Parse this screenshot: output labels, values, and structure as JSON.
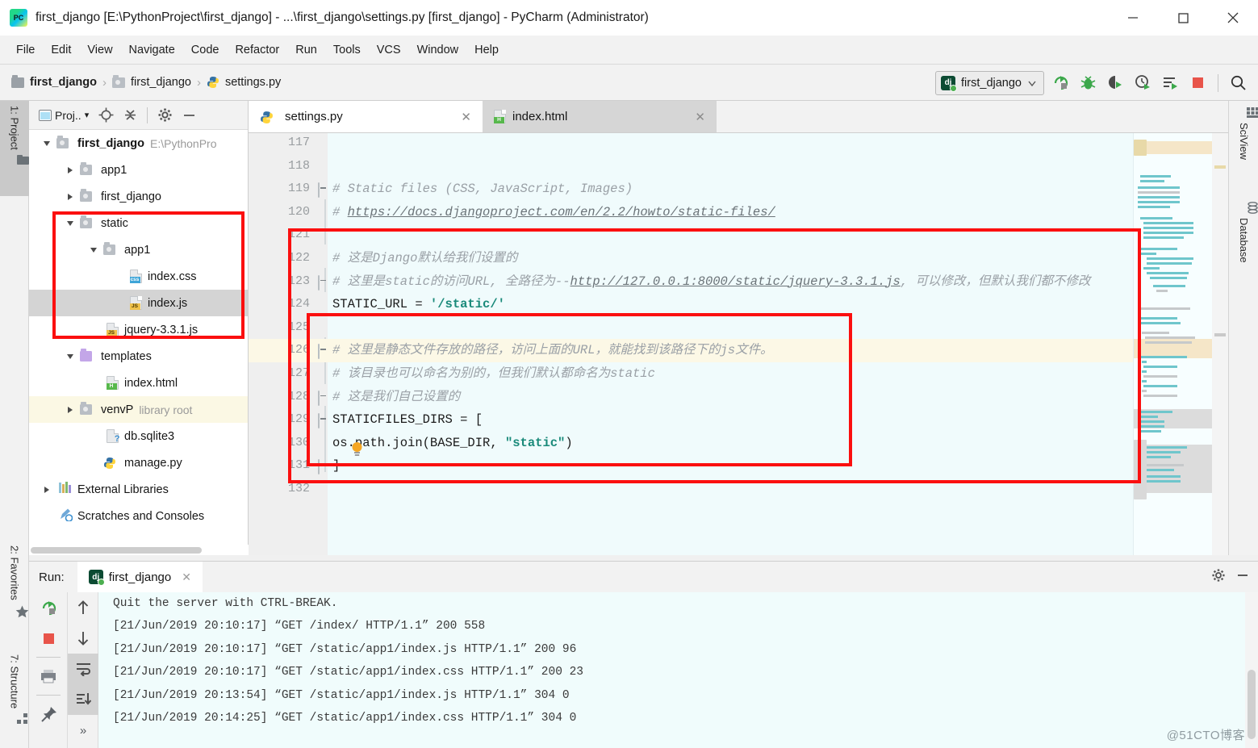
{
  "window": {
    "title": "first_django [E:\\PythonProject\\first_django] - ...\\first_django\\settings.py [first_django] - PyCharm (Administrator)",
    "logo_text": "PC",
    "minimize_icon": "minimize-icon",
    "maximize_icon": "maximize-icon",
    "close_icon": "close-icon"
  },
  "menubar": {
    "items": [
      {
        "label": "File"
      },
      {
        "label": "Edit"
      },
      {
        "label": "View"
      },
      {
        "label": "Navigate"
      },
      {
        "label": "Code"
      },
      {
        "label": "Refactor"
      },
      {
        "label": "Run"
      },
      {
        "label": "Tools"
      },
      {
        "label": "VCS"
      },
      {
        "label": "Window"
      },
      {
        "label": "Help"
      }
    ]
  },
  "navbar": {
    "breadcrumbs": [
      {
        "label": "first_django",
        "icon": "folder-icon"
      },
      {
        "label": "first_django",
        "icon": "folder-icon"
      },
      {
        "label": "settings.py",
        "icon": "python-file-icon"
      }
    ],
    "separator": "›",
    "run_config": {
      "label": "first_django",
      "icon": "django-icon",
      "chevron": "chevron-down-icon"
    },
    "toolbar_icons": [
      {
        "name": "run-icon"
      },
      {
        "name": "debug-icon"
      },
      {
        "name": "run-with-coverage-icon"
      },
      {
        "name": "profile-icon"
      },
      {
        "name": "run-dashboard-icon"
      },
      {
        "name": "stop-icon"
      },
      {
        "name": "search-everywhere-icon"
      }
    ]
  },
  "left_strip": [
    {
      "label": "1: Project",
      "icon": "project-folder-icon",
      "active": true
    },
    {
      "label": "2: Favorites",
      "icon": "star-icon",
      "active": false
    },
    {
      "label": "7: Structure",
      "icon": "structure-icon",
      "active": false
    }
  ],
  "right_strip": [
    {
      "label": "SciView",
      "icon": "sciview-icon"
    },
    {
      "label": "Database",
      "icon": "database-icon"
    }
  ],
  "project_panel": {
    "toolbar": {
      "dropdown_label": "Proj..",
      "dropdown_caret": "▾",
      "icons": [
        {
          "name": "locate-target-icon"
        },
        {
          "name": "collapse-all-icon"
        },
        {
          "name": "gear-icon"
        },
        {
          "name": "hide-icon"
        }
      ]
    },
    "tree": [
      {
        "label": "first_django",
        "suffix": "E:\\PythonPro",
        "indent": 0,
        "twisty": "down",
        "icon": "folder-icon",
        "bold": true,
        "selected": false,
        "highlight": false
      },
      {
        "label": "app1",
        "suffix": "",
        "indent": 1,
        "twisty": "right",
        "icon": "folder-icon",
        "bold": false,
        "selected": false,
        "highlight": false
      },
      {
        "label": "first_django",
        "suffix": "",
        "indent": 1,
        "twisty": "right",
        "icon": "folder-icon",
        "bold": false,
        "selected": false,
        "highlight": false
      },
      {
        "label": "static",
        "suffix": "",
        "indent": 1,
        "twisty": "down",
        "icon": "folder-icon",
        "bold": false,
        "selected": false,
        "highlight": false
      },
      {
        "label": "app1",
        "suffix": "",
        "indent": 2,
        "twisty": "down",
        "icon": "folder-icon",
        "bold": false,
        "selected": false,
        "highlight": false
      },
      {
        "label": "index.css",
        "suffix": "",
        "indent": 3,
        "twisty": "",
        "icon": "css-file-icon",
        "bold": false,
        "selected": false,
        "highlight": false
      },
      {
        "label": "index.js",
        "suffix": "",
        "indent": 3,
        "twisty": "",
        "icon": "js-file-icon",
        "bold": false,
        "selected": true,
        "highlight": false
      },
      {
        "label": "jquery-3.3.1.js",
        "suffix": "",
        "indent": 2,
        "twisty": "",
        "icon": "js-file-icon",
        "bold": false,
        "selected": false,
        "highlight": false
      },
      {
        "label": "templates",
        "suffix": "",
        "indent": 1,
        "twisty": "down",
        "icon": "templates-folder-icon",
        "bold": false,
        "selected": false,
        "highlight": false
      },
      {
        "label": "index.html",
        "suffix": "",
        "indent": 2,
        "twisty": "",
        "icon": "html-file-icon",
        "bold": false,
        "selected": false,
        "highlight": false
      },
      {
        "label": "venvP",
        "suffix": "library root",
        "indent": 1,
        "twisty": "right",
        "icon": "folder-icon",
        "bold": false,
        "selected": false,
        "highlight": true
      },
      {
        "label": "db.sqlite3",
        "suffix": "",
        "indent": 2,
        "twisty": "",
        "icon": "sqlite-file-icon",
        "bold": false,
        "selected": false,
        "highlight": false
      },
      {
        "label": "manage.py",
        "suffix": "",
        "indent": 2,
        "twisty": "",
        "icon": "python-file-icon",
        "bold": false,
        "selected": false,
        "highlight": false
      },
      {
        "label": "External Libraries",
        "suffix": "",
        "indent": 0,
        "twisty": "right",
        "icon": "libraries-icon",
        "bold": false,
        "selected": false,
        "highlight": false
      },
      {
        "label": "Scratches and Consoles",
        "suffix": "",
        "indent": 0,
        "twisty": "",
        "icon": "scratches-icon",
        "bold": false,
        "selected": false,
        "highlight": false
      }
    ]
  },
  "editor": {
    "tabs": [
      {
        "label": "settings.py",
        "icon": "python-file-icon",
        "active": true,
        "close": "✕"
      },
      {
        "label": "index.html",
        "icon": "html-file-icon",
        "active": false,
        "close": "✕"
      }
    ],
    "lines": [
      {
        "num": "117",
        "segments": [],
        "fold": "",
        "highlight": false
      },
      {
        "num": "118",
        "segments": [],
        "fold": "",
        "highlight": false
      },
      {
        "num": "119",
        "segments": [
          {
            "t": "# Static files (CSS, JavaScript, Images)",
            "c": "comment"
          }
        ],
        "fold": "collapse",
        "highlight": false
      },
      {
        "num": "120",
        "segments": [
          {
            "t": "# ",
            "c": "comment"
          },
          {
            "t": "https://docs.djangoproject.com/en/2.2/howto/static-files/",
            "c": "link"
          }
        ],
        "fold": "",
        "highlight": false
      },
      {
        "num": "121",
        "segments": [],
        "fold": "",
        "highlight": false
      },
      {
        "num": "122",
        "segments": [
          {
            "t": "# 这是Django默认给我们设置的",
            "c": "comment"
          }
        ],
        "fold": "",
        "highlight": false
      },
      {
        "num": "123",
        "segments": [
          {
            "t": "# 这里是static的访问URL, 全路径为--",
            "c": "comment"
          },
          {
            "t": "http://127.0.0.1:8000/static/jquery-3.3.1.js",
            "c": "link"
          },
          {
            "t": ", 可以修改，但默认我们都不修改",
            "c": "comment"
          }
        ],
        "fold": "end",
        "highlight": false
      },
      {
        "num": "124",
        "segments": [
          {
            "t": "STATIC_URL = ",
            "c": "kw"
          },
          {
            "t": "'/static/'",
            "c": "str"
          }
        ],
        "fold": "",
        "highlight": false
      },
      {
        "num": "125",
        "segments": [],
        "fold": "",
        "highlight": false
      },
      {
        "num": "126",
        "segments": [
          {
            "t": "# 这里是静态文件存放的路径，访问上面的URL，就能找到该路径下的js文件。",
            "c": "comment"
          }
        ],
        "fold": "collapse",
        "highlight": true
      },
      {
        "num": "127",
        "segments": [
          {
            "t": "# 该目录也可以命名为别的，但我们默认都命名为static",
            "c": "comment"
          }
        ],
        "fold": "",
        "highlight": false
      },
      {
        "num": "128",
        "segments": [
          {
            "t": "# 这是我们自己设置的",
            "c": "comment"
          }
        ],
        "fold": "end",
        "highlight": false
      },
      {
        "num": "129",
        "segments": [
          {
            "t": "STATICFILES_DIRS = [",
            "c": "kw"
          }
        ],
        "fold": "collapse",
        "highlight": false
      },
      {
        "num": "130",
        "segments": [
          {
            "t": "    os.path.join(BASE_DIR, ",
            "c": "kw"
          },
          {
            "t": "\"static\"",
            "c": "str"
          },
          {
            "t": ")",
            "c": "kw"
          }
        ],
        "fold": "",
        "highlight": false
      },
      {
        "num": "131",
        "segments": [
          {
            "t": "]",
            "c": "kw"
          }
        ],
        "fold": "end",
        "highlight": false
      },
      {
        "num": "132",
        "segments": [],
        "fold": "",
        "highlight": false
      }
    ],
    "intention_bulb": "lightbulb-icon"
  },
  "run_panel": {
    "label": "Run:",
    "tab": {
      "label": "first_django",
      "icon": "django-icon",
      "close": "✕"
    },
    "header_icons": [
      {
        "name": "gear-icon"
      },
      {
        "name": "hide-icon"
      }
    ],
    "side_icons": [
      {
        "name": "rerun-icon"
      },
      {
        "name": "stop-icon"
      },
      {
        "name": "print-icon"
      },
      {
        "name": "pin-icon"
      }
    ],
    "side_icons2": [
      {
        "name": "up-arrow-icon"
      },
      {
        "name": "down-arrow-icon"
      },
      {
        "name": "soft-wrap-icon"
      },
      {
        "name": "scroll-to-end-icon"
      },
      {
        "name": "more-icon"
      }
    ],
    "console_lines": [
      "Quit the server with CTRL-BREAK.",
      "[21/Jun/2019 20:10:17] “GET /index/ HTTP/1.1” 200 558",
      "[21/Jun/2019 20:10:17] “GET /static/app1/index.js HTTP/1.1” 200 96",
      "[21/Jun/2019 20:10:17] “GET /static/app1/index.css HTTP/1.1” 200 23",
      "[21/Jun/2019 20:13:54] “GET /static/app1/index.js HTTP/1.1” 304 0",
      "[21/Jun/2019 20:14:25] “GET /static/app1/index.css HTTP/1.1” 304 0"
    ]
  },
  "watermark": "@51CTO博客",
  "colors": {
    "annotation_red": "#fb0f0f",
    "editor_bg": "#f0fbfc",
    "highlight_line": "#fcf8e6",
    "string_green": "#1a8a7a"
  }
}
